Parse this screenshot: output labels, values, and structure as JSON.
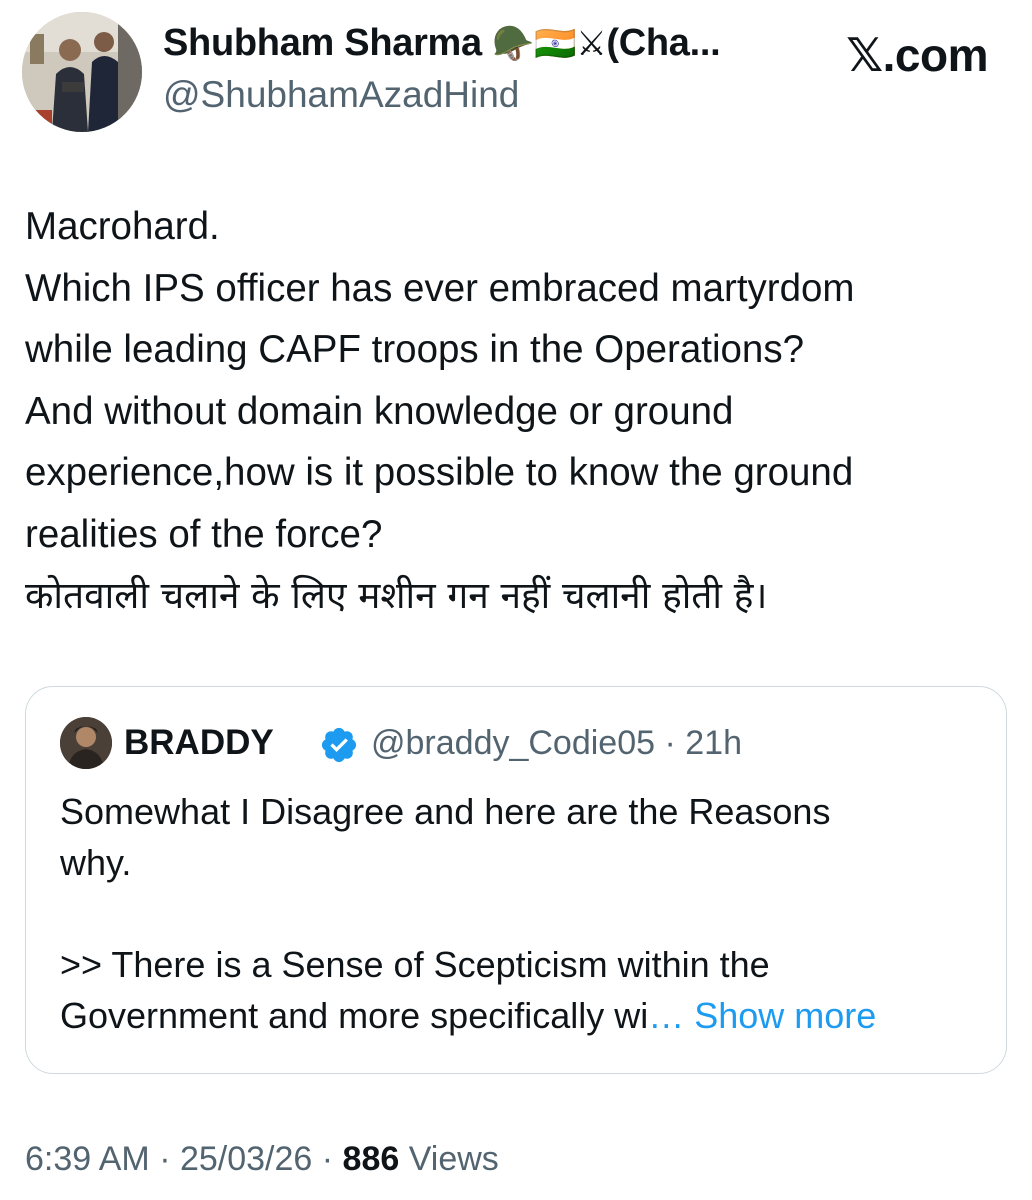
{
  "author": {
    "display_name": "Shubham Sharma",
    "name_emojis": "🪖🇮🇳⚔",
    "name_suffix": "(Cha...",
    "handle": "@ShubhamAzadHind"
  },
  "watermark": "𝕏.com",
  "tweet": {
    "lines": [
      "Macrohard.",
      "Which IPS officer has ever embraced martyrdom",
      "while leading CAPF troops in the Operations?",
      "And without domain knowledge or ground",
      "experience,how is it possible to know the ground",
      "realities of the force?",
      "कोतवाली चलाने के लिए मशीन गन नहीं चलानी होती है।"
    ]
  },
  "quote": {
    "display_name": "BRADDY",
    "handle_time": "@braddy_Codie05 · 21h",
    "verified_icon": "verified-badge-icon",
    "lines": [
      "Somewhat I Disagree and here are the Reasons",
      "why.",
      "",
      ">> There is a Sense of Scepticism within the"
    ],
    "last_line": "Government and more specifically wi",
    "show_more": "… Show more"
  },
  "meta": {
    "time_date": "6:39 AM · 25/03/26 · ",
    "views_count": "886",
    "views_label": " Views"
  },
  "colors": {
    "link": "#1d9bf0",
    "secondary_text": "#536471",
    "primary_text": "#0f1419",
    "border": "#cfd9de"
  }
}
